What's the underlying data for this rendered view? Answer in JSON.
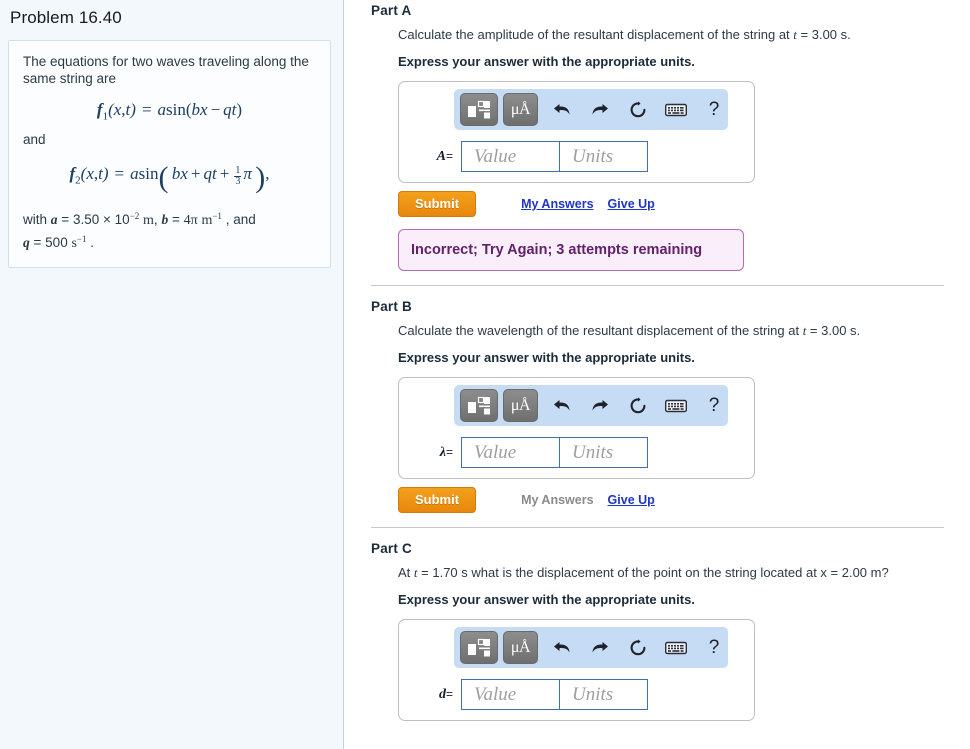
{
  "problem": {
    "title": "Problem 16.40",
    "intro": "The equations for two waves traveling along the same string are",
    "equation1": {
      "func": "f",
      "sub": "1",
      "args": "(x,t)",
      "equals": "=",
      "rhs": "a sin(bx − qt)"
    },
    "and_label": "and",
    "equation2": {
      "func": "f",
      "sub": "2",
      "args": "(x,t)",
      "equals": "=",
      "rhs": "a sin( bx + qt + 1/3 π ) ,"
    },
    "constants_line1": "with a = 3.50 × 10−2 m , b = 4π m−1 , and",
    "constants_line2": "q = 500 s−1 .",
    "constants": {
      "with": "with",
      "a_name": "a",
      "a_value": "3.50",
      "times": "×",
      "ten": "10",
      "a_exp": "−2",
      "a_unit": "m",
      "comma1": ",",
      "b_name": "b",
      "b_value": "4π",
      "b_unit": "m",
      "b_exp": "−1",
      "comma2": ",",
      "and": "and",
      "q_name": "q",
      "q_value": "500",
      "q_unit": "s",
      "q_exp": "−1",
      "period": "."
    }
  },
  "toolbar": {
    "template_button": "math-template",
    "units_button": "μÅ",
    "undo": "↶",
    "redo": "↷",
    "reset": "⟳",
    "keyboard": "keyboard",
    "help": "?"
  },
  "fields": {
    "value_placeholder": "Value",
    "units_placeholder": "Units"
  },
  "buttons": {
    "submit": "Submit",
    "my_answers": "My Answers",
    "give_up": "Give Up"
  },
  "parts": [
    {
      "label": "Part A",
      "question_pre": "Calculate the amplitude of the resultant displacement of the string at ",
      "question_var": "t",
      "question_post": " = 3.00 s.",
      "express": "Express your answer with the appropriate units.",
      "variable": "A",
      "equals": "=",
      "my_answers_enabled": true,
      "feedback": "Incorrect; Try Again; 3 attempts remaining"
    },
    {
      "label": "Part B",
      "question_pre": "Calculate the wavelength of the resultant displacement of the string at ",
      "question_var": "t",
      "question_post": " = 3.00 s.",
      "express": "Express your answer with the appropriate units.",
      "variable": "λ",
      "equals": "=",
      "my_answers_enabled": false,
      "feedback": null
    },
    {
      "label": "Part C",
      "question_pre": "At ",
      "question_var": "t",
      "question_post": " = 1.70 s what is the displacement of the point on the string located at x = 2.00 m?",
      "express": "Express your answer with the appropriate units.",
      "variable": "d",
      "equals": "=",
      "my_answers_enabled": false,
      "feedback": null
    }
  ],
  "colors": {
    "panel_bg": "#f3f8fd",
    "accent_orange": "#ee8f0f",
    "link_blue": "#1f35c4",
    "toolbar_blue": "#c6dcf4",
    "feedback_bg": "#fbeefb",
    "feedback_border": "#b36ab8",
    "feedback_text": "#61216b",
    "field_border": "#3c6fae"
  }
}
